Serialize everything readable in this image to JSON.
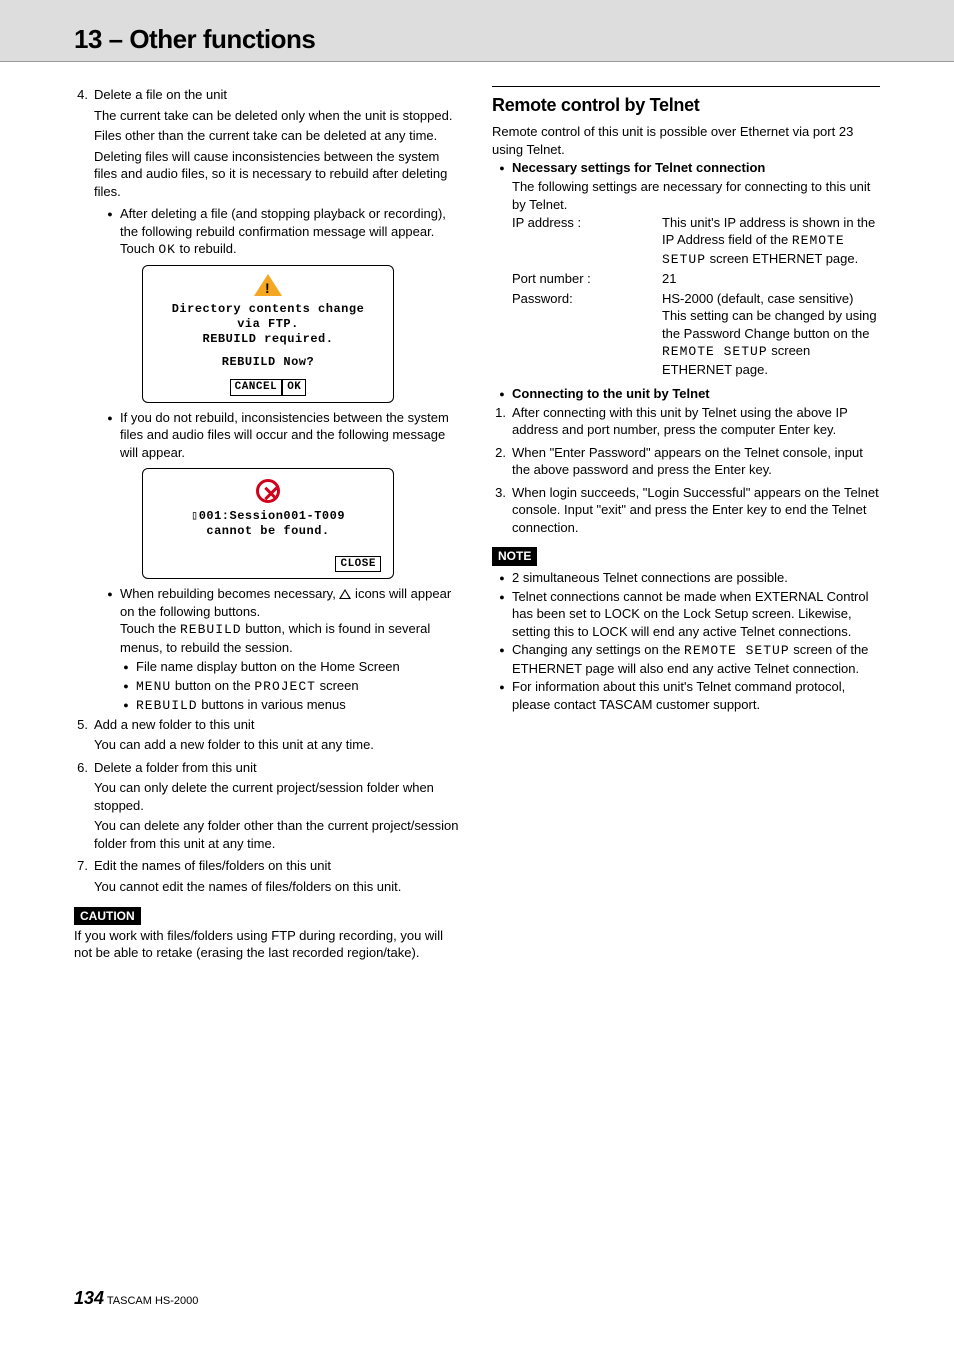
{
  "header": {
    "title": "13 – Other functions"
  },
  "left": {
    "item4": {
      "num": "4.",
      "title": "Delete a file on the unit",
      "p1": "The current take can be deleted only when the unit is stopped.",
      "p2": "Files other than the current take can be deleted at any time.",
      "p3": "Deleting files will cause inconsistencies between the system files and audio files, so it is necessary to rebuild after deleting files.",
      "b1a": "After deleting a file (and stopping playback or recording), the following rebuild confirmation message will appear. Touch ",
      "b1b": " to rebuild.",
      "ok": "OK"
    },
    "dialog1": {
      "l1": "Directory contents change",
      "l2": "via FTP.",
      "l3": "REBUILD required.",
      "l4": "REBUILD Now?",
      "cancel": "CANCEL",
      "ok": "OK"
    },
    "afterD1": "If you do not rebuild, inconsistencies between the system files and audio files will occur and the following message will appear.",
    "dialog2": {
      "l1": "▯001:Session001-T009",
      "l2": "cannot be found.",
      "close": "CLOSE"
    },
    "reb1a": "When rebuilding becomes necessary, ",
    "reb1b": " icons will appear on the following buttons.",
    "reb2a": "Touch the ",
    "reb2b": " button, which is found in several menus, to rebuild the session.",
    "rebuild": "REBUILD",
    "sub1": "File name display button on the Home Screen",
    "sub2a": "MENU",
    "sub2b": " button on the ",
    "sub2c": "PROJECT",
    "sub2d": " screen",
    "sub3a": "REBUILD",
    "sub3b": " buttons in various menus",
    "item5": {
      "num": "5.",
      "title": "Add a new folder to this unit",
      "p1": "You can add a new folder to this unit at any time."
    },
    "item6": {
      "num": "6.",
      "title": "Delete a folder from this unit",
      "p1": "You can only delete the current project/session folder when stopped.",
      "p2": "You can delete any folder other than the current project/session folder from this unit at any time."
    },
    "item7": {
      "num": "7.",
      "title": "Edit the names of files/folders on this unit",
      "p1": "You cannot edit the names of files/folders on this unit."
    },
    "caution_label": "CAUTION",
    "caution_text": "If you work with files/folders using FTP during recording, you will not be able to retake (erasing the last recorded region/take)."
  },
  "right": {
    "section_title": "Remote control by Telnet",
    "intro": "Remote control of this unit is possible over Ethernet via port 23 using Telnet.",
    "nec_title": "Necessary settings for Telnet connection",
    "nec_intro": "The following settings are necessary for connecting to this unit by Telnet.",
    "ip_k": "IP address :",
    "ip_v1": "This unit's IP address is shown in the IP Address field of the ",
    "ip_v2": "REMOTE SETUP",
    "ip_v3": " screen ETHERNET page.",
    "port_k": "Port number :",
    "port_v": "21",
    "pwd_k": "Password:",
    "pwd_v1": "HS-2000 (default, case sensitive)",
    "pwd_v2a": "This setting can be changed by using the Password Change button on the ",
    "pwd_v2b": "REMOTE SETUP",
    "pwd_v2c": " screen ETHERNET page.",
    "conn_title": "Connecting to the unit by Telnet",
    "c1_num": "1.",
    "c1": "After connecting with this unit by Telnet using the above IP address and port number, press the computer Enter key.",
    "c2_num": "2.",
    "c2": "When \"Enter Password\" appears on the Telnet console, input the above password and press the Enter key.",
    "c3_num": "3.",
    "c3": "When login succeeds, \"Login Successful\" appears on the Telnet console. Input \"exit\" and press the Enter key to end the Telnet connection.",
    "note_label": "NOTE",
    "n1": "2 simultaneous Telnet connections are possible.",
    "n2": "Telnet connections cannot be made when EXTERNAL Control has been set to LOCK on the Lock Setup screen. Likewise, setting this to LOCK will end any active Telnet connections.",
    "n3a": "Changing any settings on the ",
    "n3b": "REMOTE SETUP",
    "n3c": " screen of the ETHERNET page will also end any active Telnet connection.",
    "n4": "For information about this unit's Telnet command protocol, please contact TASCAM customer support."
  },
  "footer": {
    "page": "134",
    "product": " TASCAM  HS-2000"
  }
}
